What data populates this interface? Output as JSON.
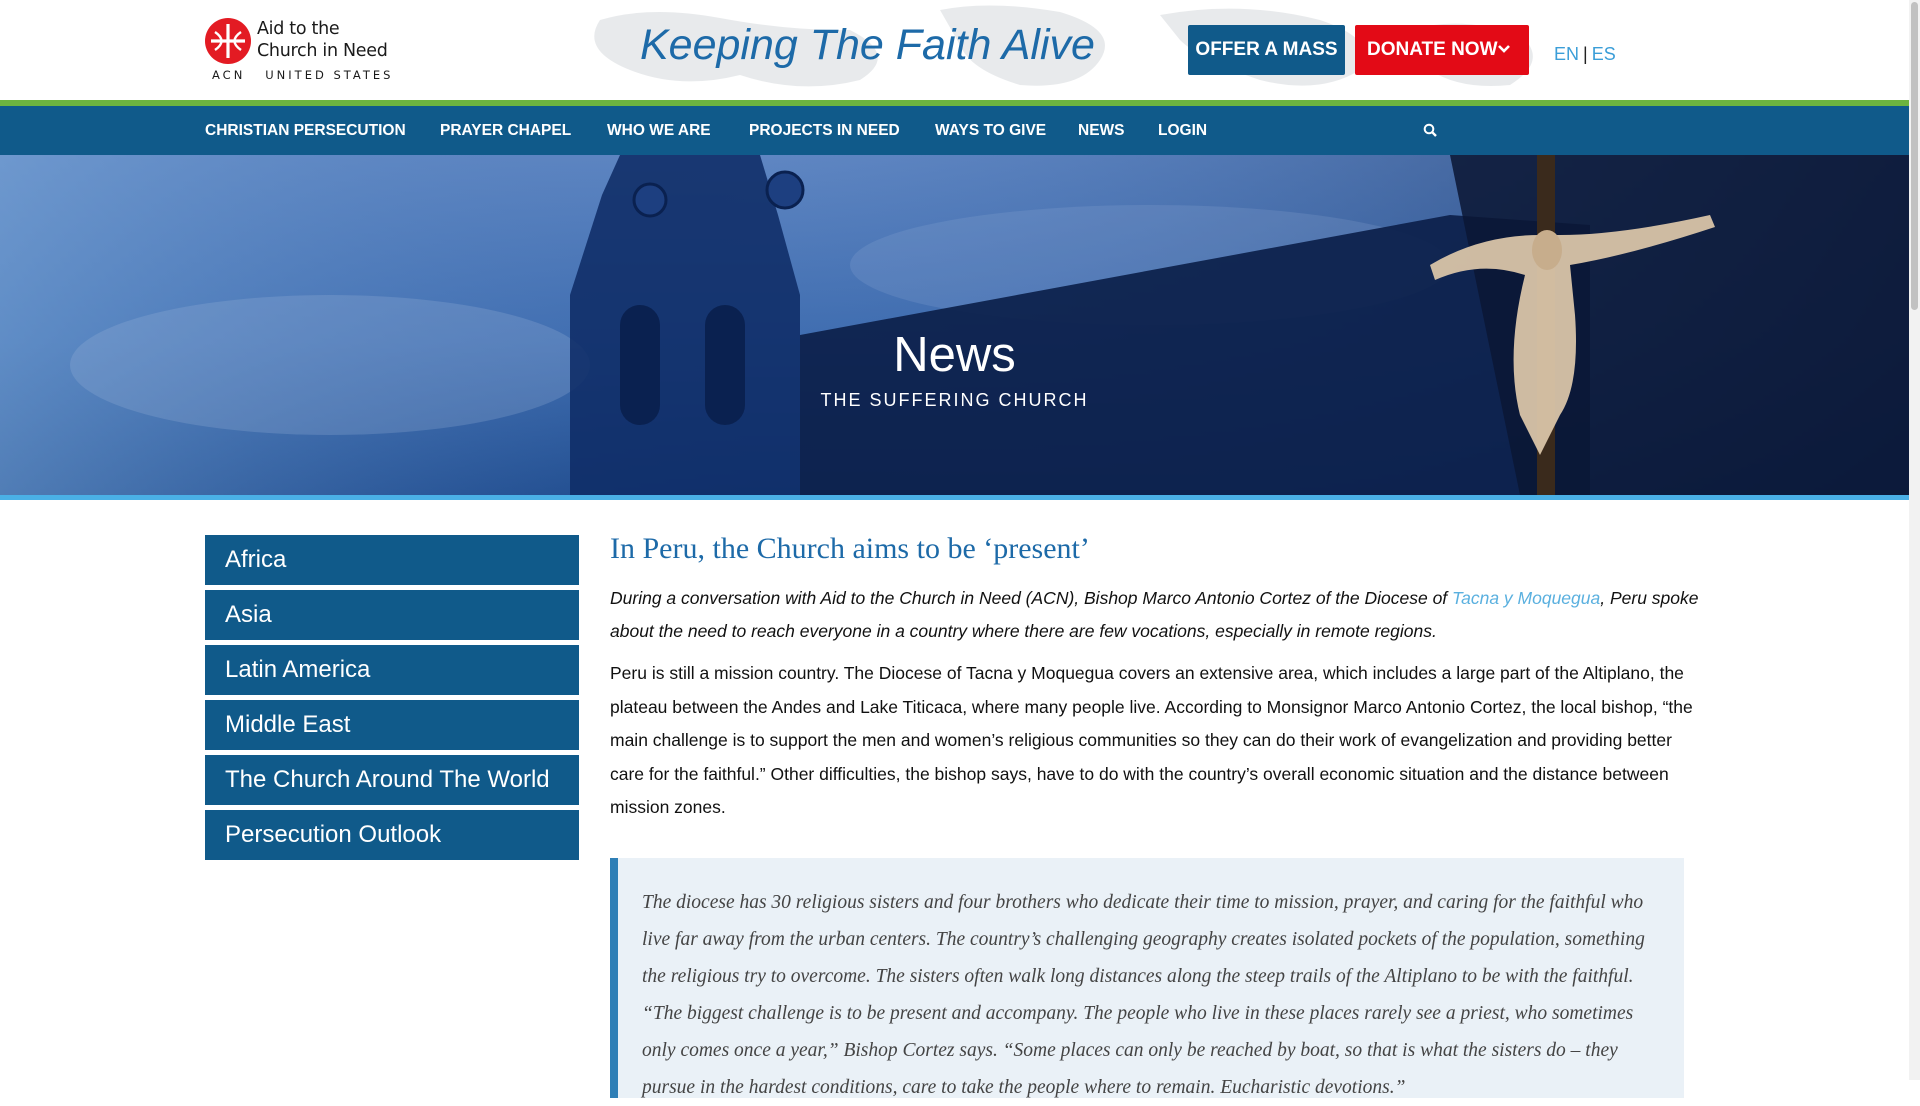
{
  "header": {
    "logo": {
      "line1": "Aid to the",
      "line2": "Church in Need",
      "sub": "ACN   UNITED STATES"
    },
    "tagline": "Keeping The Faith Alive",
    "offer_mass_label": "OFFER A MASS",
    "donate_label": "DONATE NOW",
    "lang": {
      "en": "EN",
      "sep": "|",
      "es": "ES"
    }
  },
  "nav": {
    "items": [
      "CHRISTIAN PERSECUTION",
      "PRAYER CHAPEL",
      "WHO WE ARE",
      "PROJECTS IN NEED",
      "WAYS TO GIVE",
      "NEWS",
      "LOGIN"
    ]
  },
  "hero": {
    "title": "News",
    "subtitle": "THE SUFFERING CHURCH"
  },
  "sidebar": {
    "items": [
      "Africa",
      "Asia",
      "Latin America",
      "Middle East",
      "The Church Around The World",
      "Persecution Outlook"
    ]
  },
  "article": {
    "title": "In Peru, the Church aims to be ‘present’",
    "lead_before": "During a conversation with Aid to the Church in Need (ACN), Bishop Marco Antonio Cortez of the Diocese of ",
    "lead_link": "Tacna y Moquegua",
    "lead_after": ", Peru spoke about the need to reach everyone in a country where there are few vocations, especially in remote regions.",
    "body": "Peru is still a mission country. The Diocese of Tacna y Moquegua covers an extensive area, which includes a large part of the Altiplano, the plateau between the Andes and Lake Titicaca, where many people live. According to Monsignor Marco Antonio Cortez, the local bishop, “the main challenge is to support the men and women’s religious communities so they can do their work of evangelization and providing better care for the faithful.” Other difficulties, the bishop says, have to do with the country’s overall economic situation and the distance between mission zones.",
    "quote": "The diocese has 30 religious sisters and four brothers who dedicate their time to mission, prayer, and caring for the faithful who live far away from the urban centers. The country’s challenging geography creates isolated pockets of the population, something the religious try to overcome. The sisters often walk long distances along the steep trails of the Altiplano to be with the faithful. “The biggest challenge is to be present and accompany. The people who live in these places rarely see a priest, who sometimes only comes once a year,” Bishop Cortez says. “Some places can only be reached by boat, so that is what the sisters do – they pursue in the hardest conditions, care to take the people where to remain. Eucharistic devotions.”"
  },
  "icons": {
    "search": "search-icon",
    "chevron": "chevron-down-icon",
    "logo": "acn-cross-logo-icon"
  },
  "colors": {
    "nav_blue": "#105a8a",
    "donate_red": "#e30a16",
    "accent_green": "#6db33f",
    "hero_line": "#4ab0e6",
    "title_blue": "#1d6aa8",
    "link_blue": "#5ab0df"
  }
}
